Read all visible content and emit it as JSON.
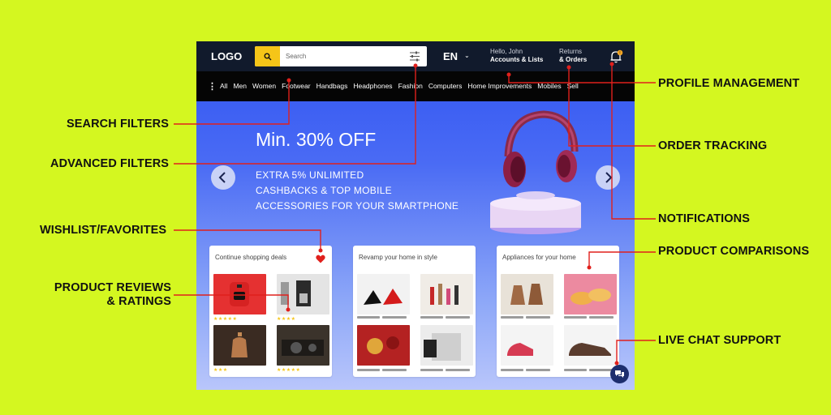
{
  "header": {
    "logo": "LOGO",
    "search_placeholder": "Search",
    "language": "EN",
    "account_greeting": "Hello, John",
    "account_label": "Accounts & Lists",
    "returns_label": "Returns",
    "orders_label": "& Orders"
  },
  "nav": {
    "items": [
      "All",
      "Men",
      "Women",
      "Footwear",
      "Handbags",
      "Headphones",
      "Fashion",
      "Computers",
      "Home Improvements",
      "Mobiles",
      "Sell"
    ]
  },
  "hero": {
    "title": "Min. 30% OFF",
    "lines": [
      "EXTRA 5% UNLIMITED",
      "CASHBACKS & TOP MOBILE",
      "ACCESSORIES FOR YOUR SMARTPHONE"
    ]
  },
  "cards": [
    {
      "title": "Continue shopping deals",
      "ratings": [
        5,
        4,
        3,
        5
      ]
    },
    {
      "title": "Revamp your home in style"
    },
    {
      "title": "Appliances for your home"
    }
  ],
  "callouts": {
    "search_filters": "SEARCH FILTERS",
    "advanced_filters": "ADVANCED FILTERS",
    "wishlist": "WISHLIST/FAVORITES",
    "reviews_1": "PRODUCT REVIEWS",
    "reviews_2": "& RATINGS",
    "profile": "PROFILE MANAGEMENT",
    "order_tracking": "ORDER TRACKING",
    "notifications": "NOTIFICATIONS",
    "comparisons": "PRODUCT COMPARISONS",
    "live_chat": "LIVE CHAT SUPPORT"
  },
  "colors": {
    "background": "#d4f720",
    "accent": "#f5c518",
    "callout_line": "#e0201c",
    "header_bg": "#111a2c"
  },
  "icons": [
    "search-icon",
    "filter-icon",
    "chevron-down-icon",
    "bell-icon",
    "menu-icon",
    "chevron-left-icon",
    "chevron-right-icon",
    "heart-icon",
    "chat-icon",
    "star-icon"
  ]
}
